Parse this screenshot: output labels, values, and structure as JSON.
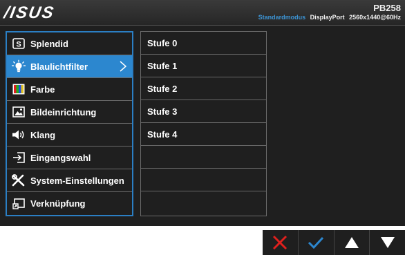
{
  "header": {
    "brand": "/ISUS",
    "model": "PB258",
    "mode": "Standardmodus",
    "input": "DisplayPort",
    "resolution": "2560x1440@60Hz"
  },
  "menu": {
    "items": [
      {
        "label": "Splendid",
        "icon": "splendid-icon"
      },
      {
        "label": "Blaulichtfilter",
        "icon": "bulb-icon",
        "active": true
      },
      {
        "label": "Farbe",
        "icon": "color-bars-icon"
      },
      {
        "label": "Bildeinrichtung",
        "icon": "image-icon"
      },
      {
        "label": "Klang",
        "icon": "speaker-icon"
      },
      {
        "label": "Eingangswahl",
        "icon": "input-icon"
      },
      {
        "label": "System-Einstellungen",
        "icon": "tools-icon"
      },
      {
        "label": "Verknüpfung",
        "icon": "shortcut-icon"
      }
    ]
  },
  "submenu": {
    "items": [
      "Stufe 0",
      "Stufe 1",
      "Stufe 2",
      "Stufe 3",
      "Stufe 4",
      "",
      "",
      ""
    ]
  },
  "buttons": [
    {
      "name": "close",
      "icon": "close-icon",
      "color": "#e0201d"
    },
    {
      "name": "confirm",
      "icon": "check-icon",
      "color": "#2c87cf"
    },
    {
      "name": "up",
      "icon": "triangle-up-icon",
      "color": "#ffffff"
    },
    {
      "name": "down",
      "icon": "triangle-down-icon",
      "color": "#ffffff"
    }
  ],
  "colors": {
    "accent": "#2c87cf",
    "background": "#1f1f1f",
    "close": "#e0201d"
  }
}
